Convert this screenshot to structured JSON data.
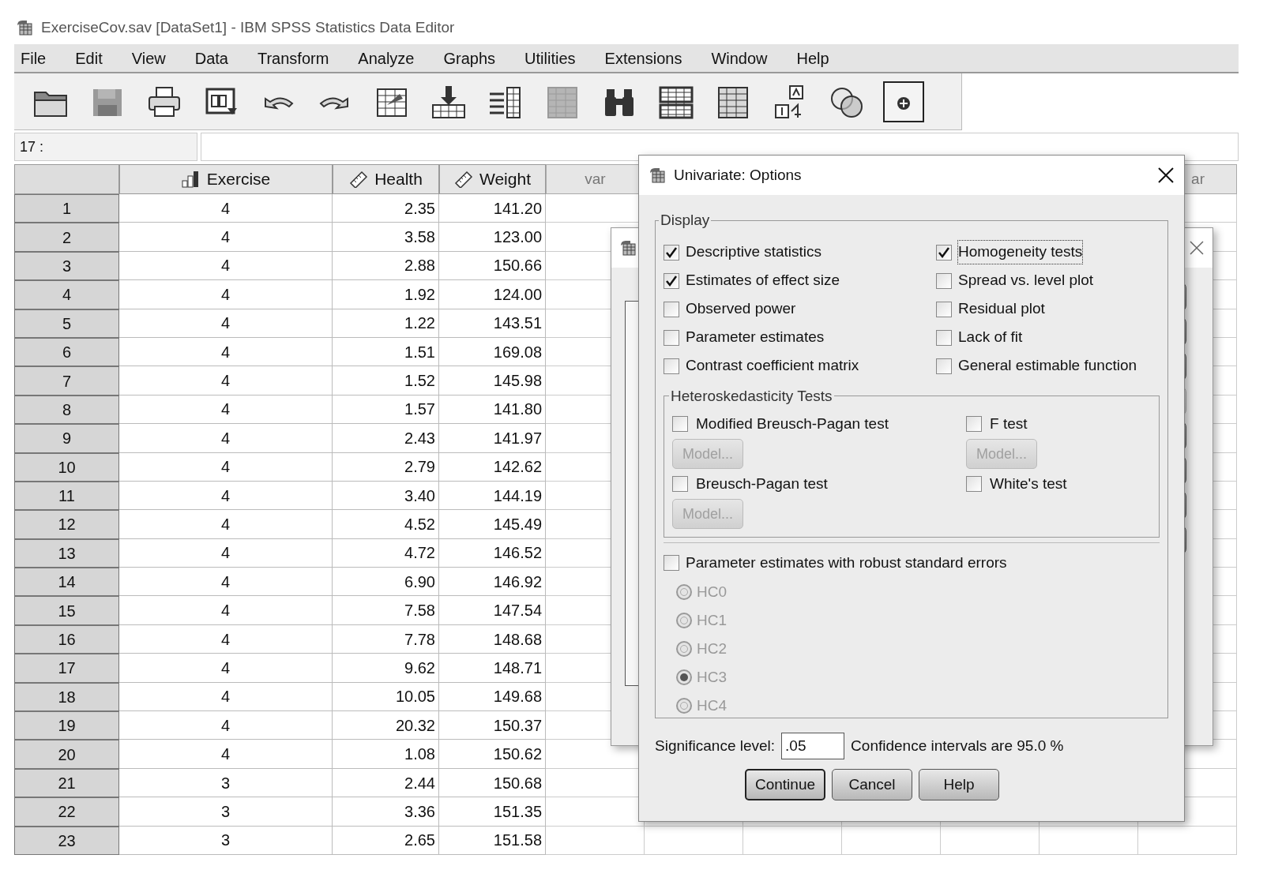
{
  "window": {
    "title": "ExerciseCov.sav [DataSet1] - IBM SPSS Statistics Data Editor"
  },
  "menu": [
    "File",
    "Edit",
    "View",
    "Data",
    "Transform",
    "Analyze",
    "Graphs",
    "Utilities",
    "Extensions",
    "Window",
    "Help"
  ],
  "toolbar": [
    {
      "kind": "open",
      "disabled": false,
      "pressed": false
    },
    {
      "kind": "save",
      "disabled": true,
      "pressed": false
    },
    {
      "kind": "print",
      "disabled": false,
      "pressed": false
    },
    {
      "kind": "recall",
      "disabled": false,
      "pressed": false
    },
    {
      "kind": "undo",
      "disabled": false,
      "pressed": false
    },
    {
      "kind": "redo",
      "disabled": false,
      "pressed": false
    },
    {
      "kind": "goto",
      "disabled": false,
      "pressed": false
    },
    {
      "kind": "insert",
      "disabled": false,
      "pressed": false
    },
    {
      "kind": "variables",
      "disabled": false,
      "pressed": false
    },
    {
      "kind": "grid",
      "disabled": true,
      "pressed": false
    },
    {
      "kind": "find",
      "disabled": false,
      "pressed": false
    },
    {
      "kind": "rows",
      "disabled": false,
      "pressed": false
    },
    {
      "kind": "grid",
      "disabled": false,
      "pressed": false
    },
    {
      "kind": "labels",
      "disabled": false,
      "pressed": false
    },
    {
      "kind": "circles",
      "disabled": false,
      "pressed": false
    },
    {
      "kind": "plus",
      "disabled": false,
      "pressed": true
    }
  ],
  "cell_ref": {
    "label": "17 :"
  },
  "grid": {
    "columns": [
      {
        "label": "Exercise",
        "kind": "ordinal"
      },
      {
        "label": "Health",
        "kind": "scale"
      },
      {
        "label": "Weight",
        "kind": "scale"
      },
      {
        "label": "var",
        "kind": "empty"
      }
    ],
    "right_header": "ar",
    "rows": [
      {
        "number": "1",
        "cells": [
          "4",
          "2.35",
          "141.20"
        ]
      },
      {
        "number": "2",
        "cells": [
          "4",
          "3.58",
          "123.00"
        ]
      },
      {
        "number": "3",
        "cells": [
          "4",
          "2.88",
          "150.66"
        ]
      },
      {
        "number": "4",
        "cells": [
          "4",
          "1.92",
          "124.00"
        ]
      },
      {
        "number": "5",
        "cells": [
          "4",
          "1.22",
          "143.51"
        ]
      },
      {
        "number": "6",
        "cells": [
          "4",
          "1.51",
          "169.08"
        ]
      },
      {
        "number": "7",
        "cells": [
          "4",
          "1.52",
          "145.98"
        ]
      },
      {
        "number": "8",
        "cells": [
          "4",
          "1.57",
          "141.80"
        ]
      },
      {
        "number": "9",
        "cells": [
          "4",
          "2.43",
          "141.97"
        ]
      },
      {
        "number": "10",
        "cells": [
          "4",
          "2.79",
          "142.62"
        ]
      },
      {
        "number": "11",
        "cells": [
          "4",
          "3.40",
          "144.19"
        ]
      },
      {
        "number": "12",
        "cells": [
          "4",
          "4.52",
          "145.49"
        ]
      },
      {
        "number": "13",
        "cells": [
          "4",
          "4.72",
          "146.52"
        ]
      },
      {
        "number": "14",
        "cells": [
          "4",
          "6.90",
          "146.92"
        ]
      },
      {
        "number": "15",
        "cells": [
          "4",
          "7.58",
          "147.54"
        ]
      },
      {
        "number": "16",
        "cells": [
          "4",
          "7.78",
          "148.68"
        ]
      },
      {
        "number": "17",
        "cells": [
          "4",
          "9.62",
          "148.71"
        ]
      },
      {
        "number": "18",
        "cells": [
          "4",
          "10.05",
          "149.68"
        ]
      },
      {
        "number": "19",
        "cells": [
          "4",
          "20.32",
          "150.37"
        ]
      },
      {
        "number": "20",
        "cells": [
          "4",
          "1.08",
          "150.62"
        ]
      },
      {
        "number": "21",
        "cells": [
          "3",
          "2.44",
          "150.68"
        ]
      },
      {
        "number": "22",
        "cells": [
          "3",
          "3.36",
          "151.35"
        ]
      },
      {
        "number": "23",
        "cells": [
          "3",
          "2.65",
          "151.58"
        ]
      }
    ]
  },
  "dialog": {
    "title": "Univariate: Options",
    "display": {
      "legend": "Display",
      "items": [
        {
          "label": "Descriptive statistics",
          "checked": true,
          "focused": false
        },
        {
          "label": "Homogeneity tests",
          "checked": true,
          "focused": true
        },
        {
          "label": "Estimates of effect size",
          "checked": true,
          "focused": false
        },
        {
          "label": "Spread vs. level plot",
          "checked": false,
          "focused": false
        },
        {
          "label": "Observed power",
          "checked": false,
          "focused": false
        },
        {
          "label": "Residual plot",
          "checked": false,
          "focused": false
        },
        {
          "label": "Parameter estimates",
          "checked": false,
          "focused": false
        },
        {
          "label": "Lack of fit",
          "checked": false,
          "focused": false
        },
        {
          "label": "Contrast coefficient matrix",
          "checked": false,
          "focused": false
        },
        {
          "label": "General estimable function",
          "checked": false,
          "focused": false
        }
      ]
    },
    "hetero": {
      "legend": "Heteroskedasticity Tests",
      "tests": [
        {
          "label": "Modified Breusch-Pagan test",
          "checked": false,
          "model": {
            "label": "Model...",
            "disabled": true
          }
        },
        {
          "label": "F test",
          "checked": false,
          "model": {
            "label": "Model...",
            "disabled": true
          }
        },
        {
          "label": "Breusch-Pagan test",
          "checked": false,
          "model": {
            "label": "Model...",
            "disabled": true
          }
        },
        {
          "label": "White's test",
          "checked": false
        }
      ]
    },
    "robust": {
      "label": "Parameter estimates with robust standard errors",
      "checked": false
    },
    "methods": [
      {
        "label": "HC0",
        "selected": false,
        "disabled": true
      },
      {
        "label": "HC1",
        "selected": false,
        "disabled": true
      },
      {
        "label": "HC2",
        "selected": false,
        "disabled": true
      },
      {
        "label": "HC3",
        "selected": true,
        "disabled": true
      },
      {
        "label": "HC4",
        "selected": false,
        "disabled": true
      }
    ],
    "significance": {
      "label": "Significance level:",
      "value": ".05"
    },
    "confidence": "Confidence intervals are 95.0 %",
    "buttons": [
      {
        "label": "Continue",
        "default": true
      },
      {
        "label": "Cancel",
        "default": false
      },
      {
        "label": "Help",
        "default": false
      }
    ]
  }
}
